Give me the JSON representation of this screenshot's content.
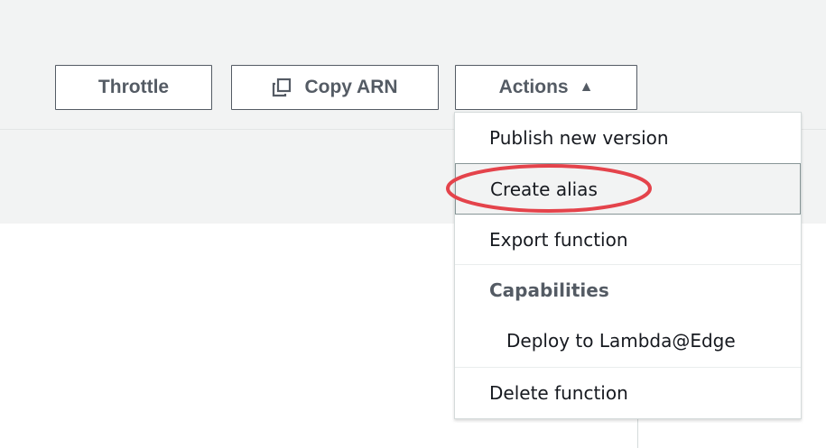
{
  "toolbar": {
    "throttle_label": "Throttle",
    "copy_arn_label": "Copy ARN",
    "actions_label": "Actions",
    "actions_indicator": "▲"
  },
  "actions_menu": {
    "items": [
      {
        "label": "Publish new version"
      },
      {
        "label": "Create alias",
        "highlighted": true
      },
      {
        "label": "Export function"
      },
      {
        "label": "Capabilities",
        "type": "header"
      },
      {
        "label": "Deploy to Lambda@Edge",
        "indent": true
      },
      {
        "label": "Delete function"
      }
    ]
  },
  "annotation": {
    "color": "#e4434b",
    "target": "Create alias"
  }
}
